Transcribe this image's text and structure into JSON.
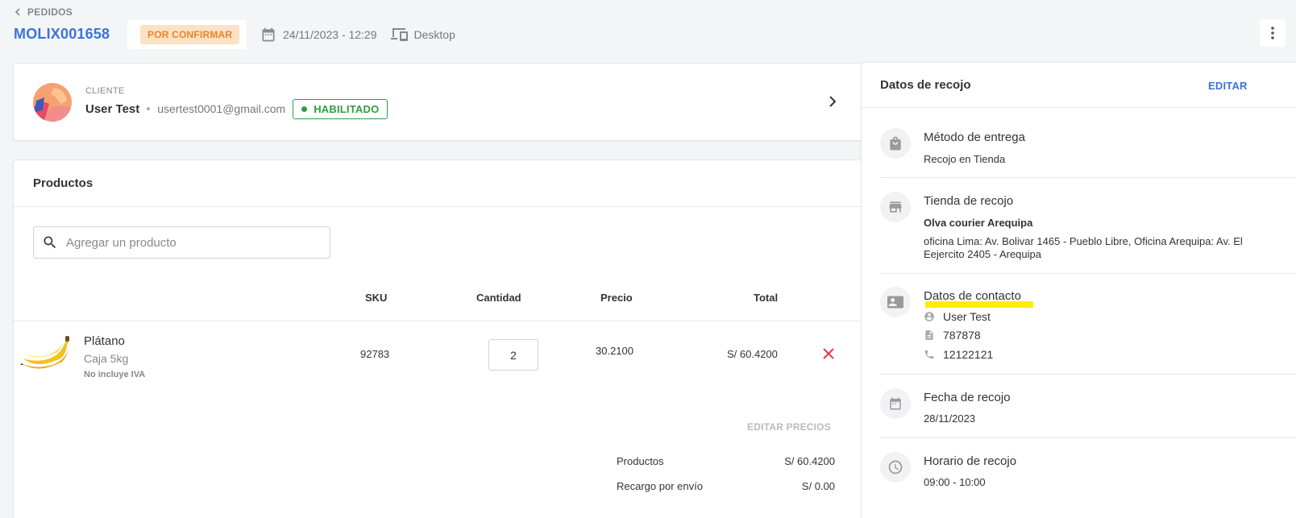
{
  "header": {
    "back_label": "PEDIDOS",
    "order_id": "MOLIX001658",
    "status": "POR CONFIRMAR",
    "datetime": "24/11/2023 - 12:29",
    "device": "Desktop"
  },
  "customer": {
    "label": "CLIENTE",
    "name": "User Test",
    "email": "usertest0001@gmail.com",
    "status": "HABILITADO"
  },
  "products": {
    "title": "Productos",
    "search_placeholder": "Agregar un producto",
    "columns": {
      "sku": "SKU",
      "qty": "Cantidad",
      "price": "Precio",
      "total": "Total"
    },
    "items": [
      {
        "name": "Plátano",
        "variant": "Caja 5kg",
        "note": "No incluye IVA",
        "sku": "92783",
        "qty": "2",
        "price": "30.2100",
        "total": "S/ 60.4200"
      }
    ],
    "edit_prices": "EDITAR PRECIOS",
    "summary": [
      {
        "label": "Productos",
        "value": "S/ 60.4200"
      },
      {
        "label": "Recargo por envío",
        "value": "S/ 0.00"
      }
    ]
  },
  "pickup": {
    "title": "Datos de recojo",
    "edit": "EDITAR",
    "method_title": "Método de entrega",
    "method_value": "Recojo en Tienda",
    "store_title": "Tienda de recojo",
    "store_name": "Olva courier Arequipa",
    "store_address": "oficina Lima: Av. Bolivar 1465 - Pueblo Libre, Oficina Arequipa: Av. El Eejercito 2405 - Arequipa",
    "contact_title": "Datos de contacto",
    "contact_name": "User Test",
    "contact_doc": "787878",
    "contact_phone": "12122121",
    "date_title": "Fecha de recojo",
    "date_value": "28/11/2023",
    "time_title": "Horario de recojo",
    "time_value": "09:00 - 10:00"
  },
  "colors": {
    "accent": "#3b73d9",
    "status_bg": "#fde1c4",
    "status_text": "#e7862a",
    "enabled": "#2e9e42",
    "delete": "#e53950",
    "highlight": "#ffee00"
  }
}
